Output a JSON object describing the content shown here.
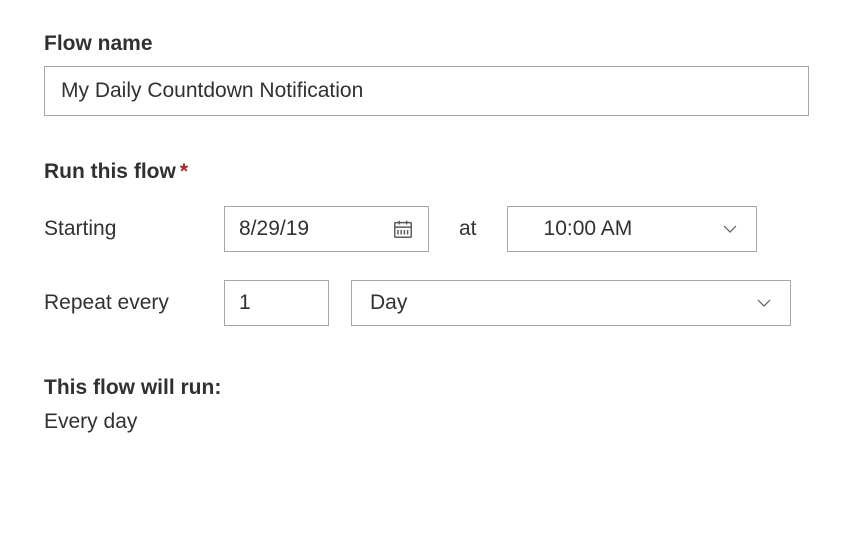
{
  "flowName": {
    "label": "Flow name",
    "value": "My Daily Countdown Notification"
  },
  "runFlow": {
    "label": "Run this flow",
    "required": "*",
    "starting": {
      "label": "Starting",
      "date": "8/29/19",
      "atLabel": "at",
      "time": "10:00 AM"
    },
    "repeat": {
      "label": "Repeat every",
      "count": "1",
      "unit": "Day"
    }
  },
  "summary": {
    "label": "This flow will run:",
    "text": "Every day"
  }
}
